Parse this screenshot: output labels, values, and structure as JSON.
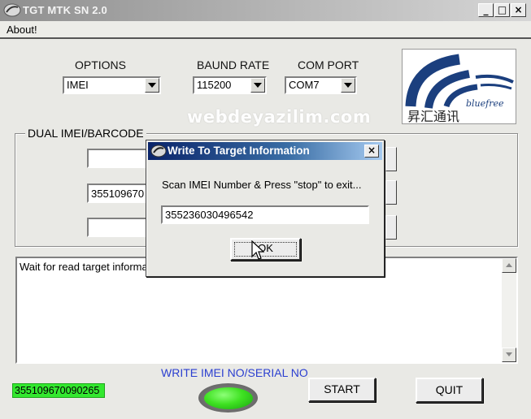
{
  "window": {
    "title": "TGT MTK SN 2.0",
    "controls": {
      "minimize": "_",
      "maximize": "□",
      "close": "×"
    }
  },
  "menu": {
    "about": "About!"
  },
  "options": {
    "options_label": "OPTIONS",
    "options_value": "IMEI",
    "baud_label": "BAUND RATE",
    "baud_value": "115200",
    "port_label": "COM PORT",
    "port_value": "COM7"
  },
  "logo": {
    "icon": "vendor-logo-image",
    "text": "bluefree",
    "cjk": "昇汇通讯"
  },
  "watermark": "webdeyazilim.com",
  "dual_group": {
    "title": "DUAL IMEI/BARCODE",
    "field1": "",
    "field2": "355109670",
    "field3": ""
  },
  "log": {
    "text": "Wait for read target informa"
  },
  "status": {
    "imei_display": "355109670090265",
    "write_label": "WRITE IMEI NO/SERIAL NO",
    "start_label": "START",
    "quit_label": "QUIT"
  },
  "dialog": {
    "title": "Write To Target Information",
    "close": "×",
    "message": "Scan IMEI Number & Press \"stop\" to exit...",
    "input_value": "355236030496542",
    "ok_label": "OK"
  },
  "colors": {
    "status_green": "#33e82f",
    "write_label_blue": "#2b3fd0",
    "dialog_title_start": "#0a246a",
    "dialog_title_end": "#a6caf0"
  }
}
